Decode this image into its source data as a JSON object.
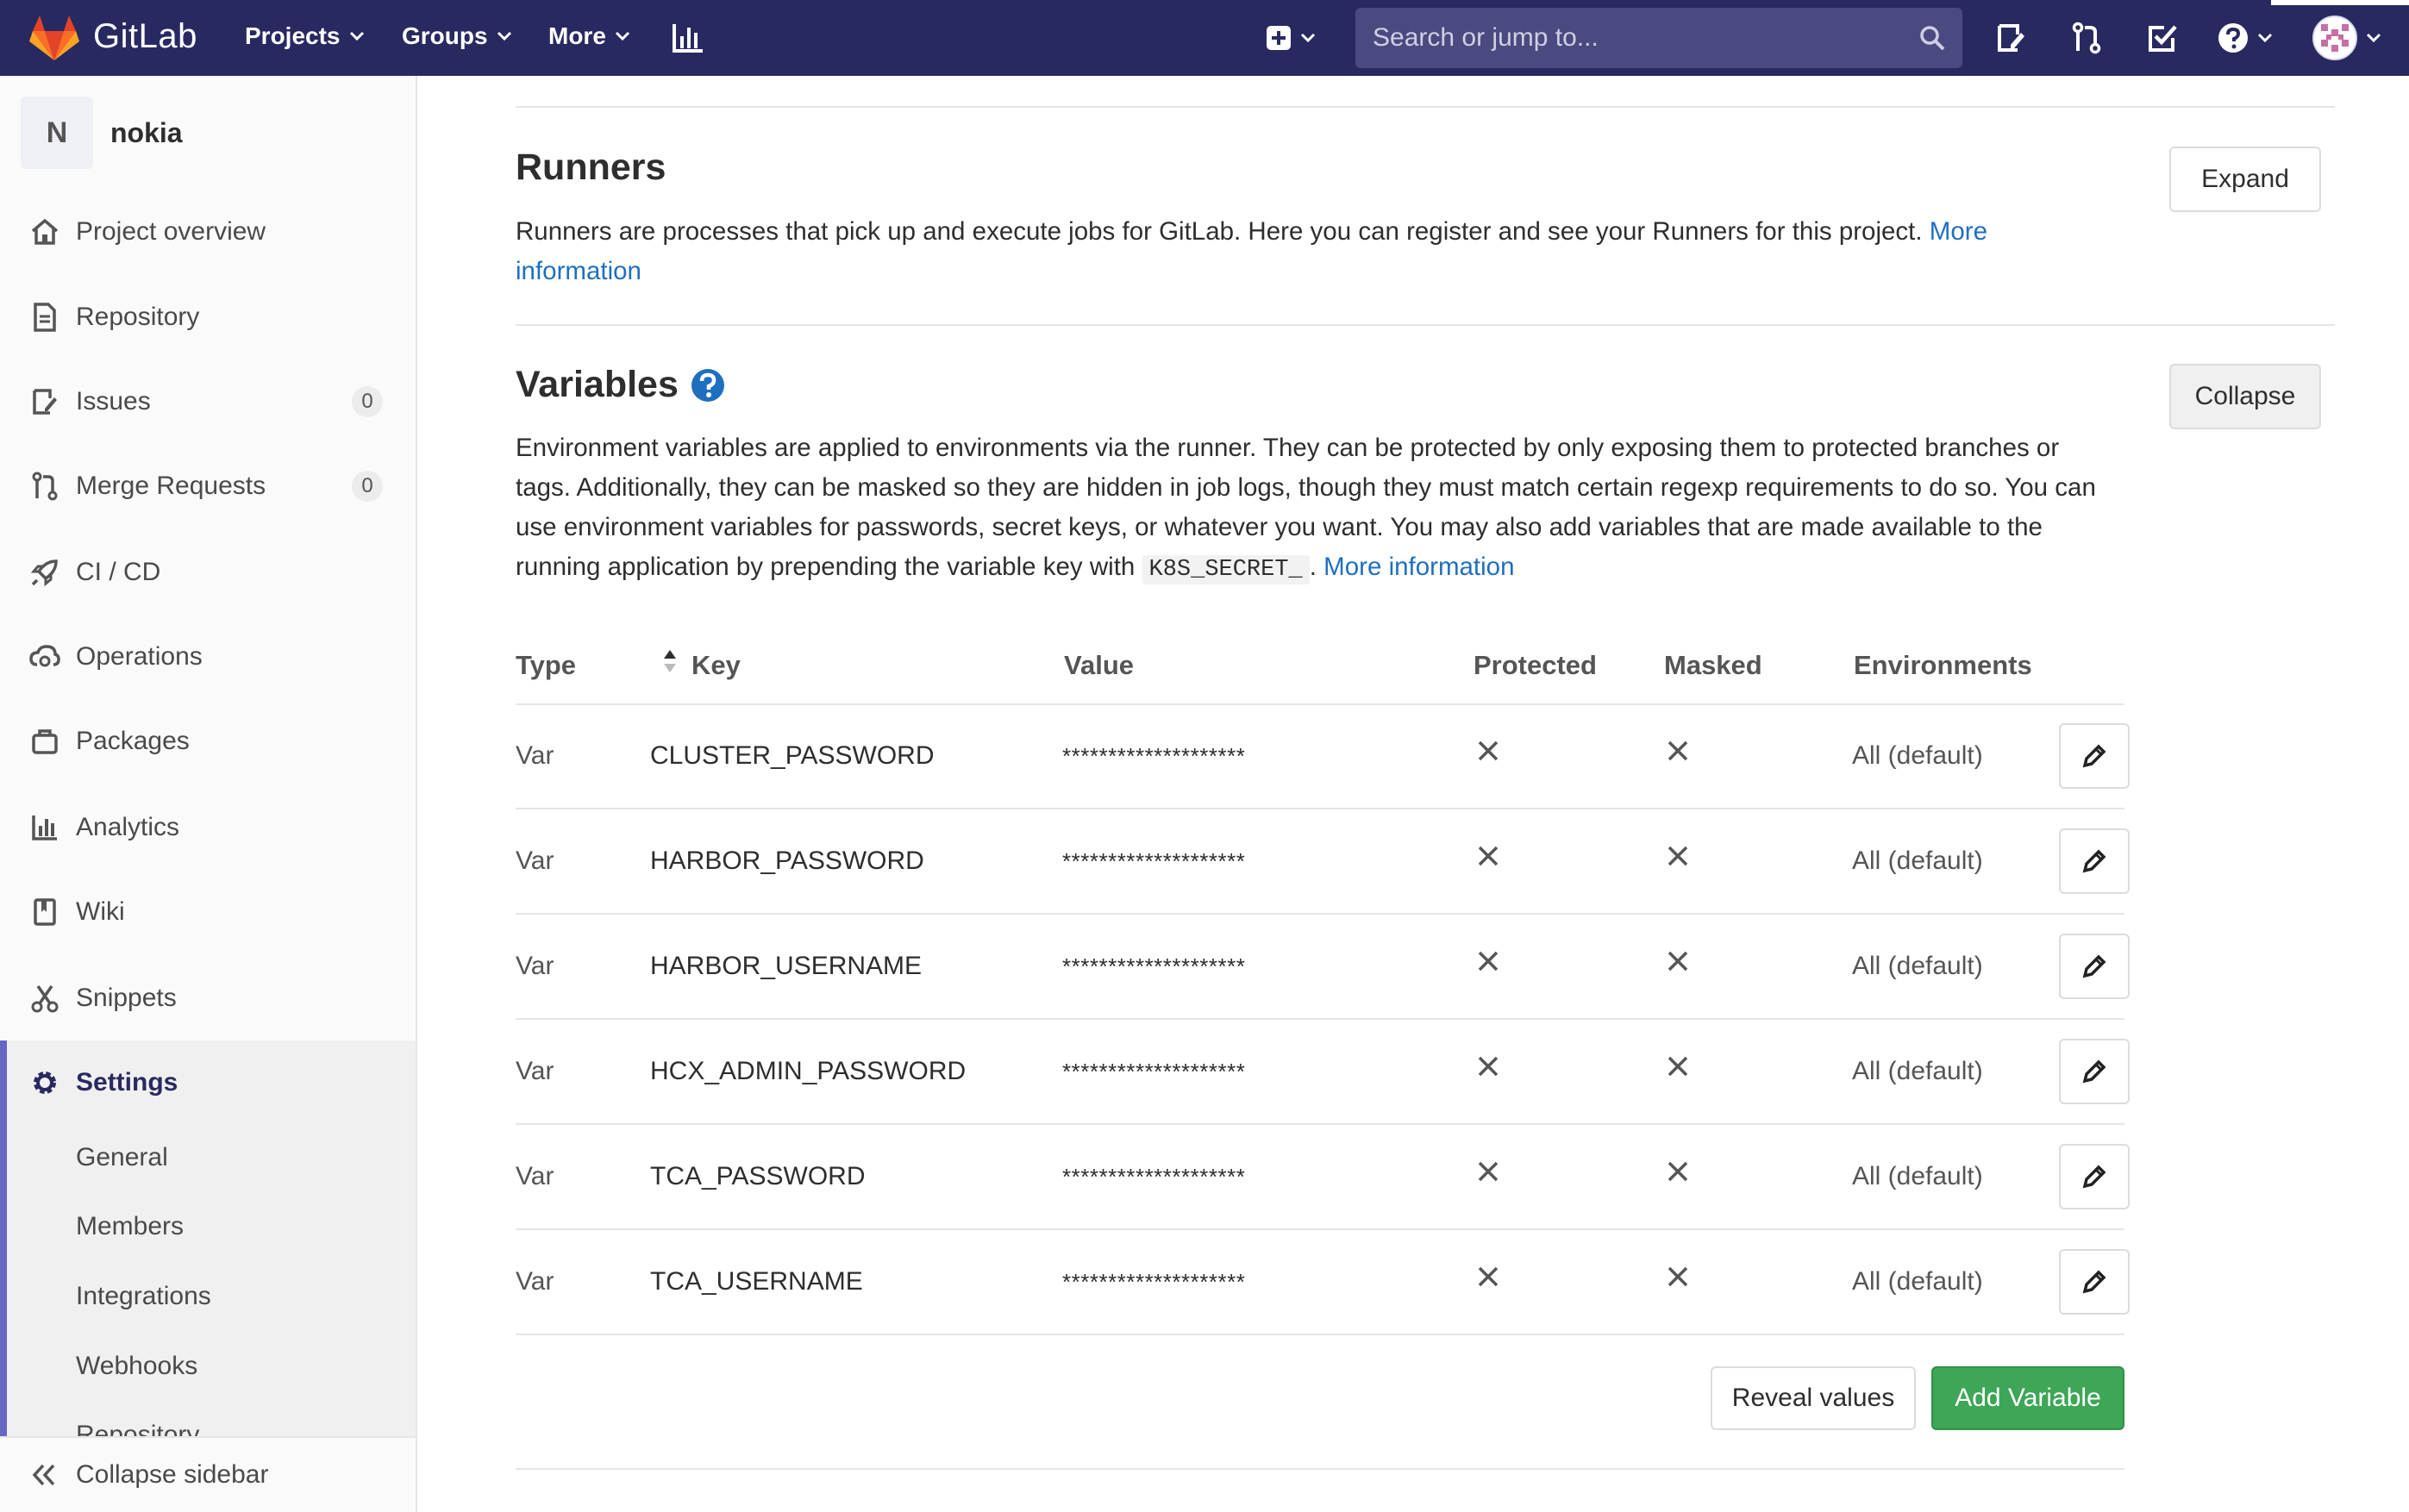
{
  "navbar": {
    "brand": "GitLab",
    "menu": [
      {
        "label": "Projects"
      },
      {
        "label": "Groups"
      },
      {
        "label": "More"
      }
    ],
    "search_placeholder": "Search or jump to..."
  },
  "sidebar": {
    "project_initial": "N",
    "project_name": "nokia",
    "items": [
      {
        "label": "Project overview",
        "icon": "home-icon"
      },
      {
        "label": "Repository",
        "icon": "doc-icon"
      },
      {
        "label": "Issues",
        "icon": "issues-icon",
        "badge": "0"
      },
      {
        "label": "Merge Requests",
        "icon": "merge-request-icon",
        "badge": "0"
      },
      {
        "label": "CI / CD",
        "icon": "rocket-icon"
      },
      {
        "label": "Operations",
        "icon": "cloud-gear-icon"
      },
      {
        "label": "Packages",
        "icon": "package-icon"
      },
      {
        "label": "Analytics",
        "icon": "chart-icon"
      },
      {
        "label": "Wiki",
        "icon": "book-icon"
      },
      {
        "label": "Snippets",
        "icon": "scissors-icon"
      },
      {
        "label": "Settings",
        "icon": "gear-icon"
      }
    ],
    "settings_sub": [
      "General",
      "Members",
      "Integrations",
      "Webhooks",
      "Repository"
    ],
    "collapse_label": "Collapse sidebar"
  },
  "runners": {
    "title": "Runners",
    "description": "Runners are processes that pick up and execute jobs for GitLab. Here you can register and see your Runners for this project.",
    "link": "More information",
    "button": "Expand"
  },
  "variables": {
    "title": "Variables",
    "description": "Environment variables are applied to environments via the runner. They can be protected by only exposing them to protected branches or tags. Additionally, they can be masked so they are hidden in job logs, though they must match certain regexp requirements to do so. You can use environment variables for passwords, secret keys, or whatever you want. You may also add variables that are made available to the running application by prepending the variable key with",
    "code": "K8S_SECRET_",
    "after_code": ".",
    "link": "More information",
    "button": "Collapse",
    "columns": [
      "Type",
      "Key",
      "Value",
      "Protected",
      "Masked",
      "Environments"
    ],
    "rows": [
      {
        "type": "Var",
        "key": "CLUSTER_PASSWORD",
        "value": "********************",
        "environment": "All (default)"
      },
      {
        "type": "Var",
        "key": "HARBOR_PASSWORD",
        "value": "********************",
        "environment": "All (default)"
      },
      {
        "type": "Var",
        "key": "HARBOR_USERNAME",
        "value": "********************",
        "environment": "All (default)"
      },
      {
        "type": "Var",
        "key": "HCX_ADMIN_PASSWORD",
        "value": "********************",
        "environment": "All (default)"
      },
      {
        "type": "Var",
        "key": "TCA_PASSWORD",
        "value": "********************",
        "environment": "All (default)"
      },
      {
        "type": "Var",
        "key": "TCA_USERNAME",
        "value": "********************",
        "environment": "All (default)"
      }
    ],
    "reveal_button": "Reveal values",
    "add_button": "Add Variable"
  },
  "colors": {
    "navbar": "#292961",
    "link": "#1f6fbf",
    "accent_green": "#3ea657",
    "settings_accent": "#6666c4"
  }
}
